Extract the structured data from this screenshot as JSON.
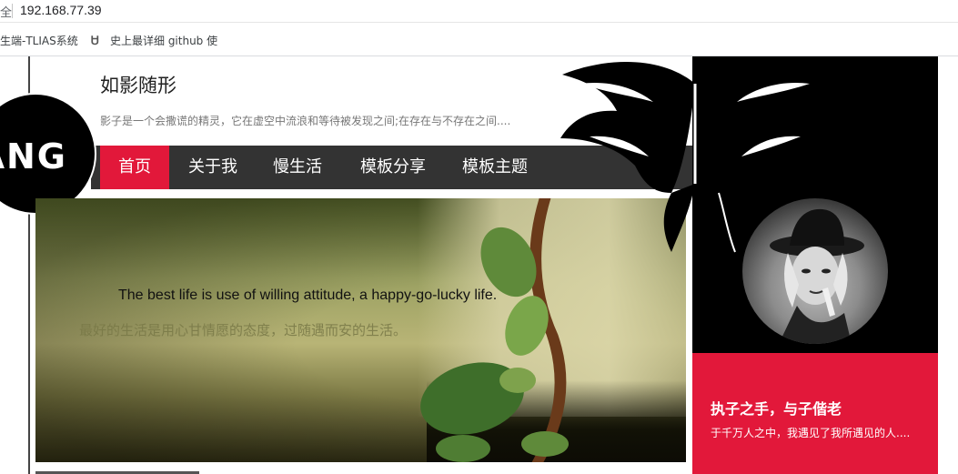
{
  "browser": {
    "secure_label": "全",
    "url": "192.168.77.39",
    "bookmarks": [
      {
        "label": "生端-TLIAS系统"
      },
      {
        "label": "史上最详细 github 使"
      }
    ]
  },
  "site": {
    "title": "如影随形",
    "subtitle": "影子是一个会撒谎的精灵，它在虚空中流浪和等待被发现之间;在存在与不存在之间....",
    "logo_text": "ANG"
  },
  "nav": {
    "items": [
      {
        "label": "首页",
        "active": true
      },
      {
        "label": "关于我",
        "active": false
      },
      {
        "label": "慢生活",
        "active": false
      },
      {
        "label": "模板分享",
        "active": false
      },
      {
        "label": "模板主题",
        "active": false
      }
    ]
  },
  "banner": {
    "headline": "The best life is use of willing attitude, a happy-go-lucky life.",
    "caption": "最好的生活是用心甘情愿的态度，过随遇而安的生活。"
  },
  "sidebar": {
    "title": "执子之手，与子偕老",
    "description": "于千万人之中，我遇见了我所遇见的人...."
  },
  "colors": {
    "accent": "#e2183a",
    "nav_bg": "#333333",
    "sidebar_bg": "#000000"
  }
}
